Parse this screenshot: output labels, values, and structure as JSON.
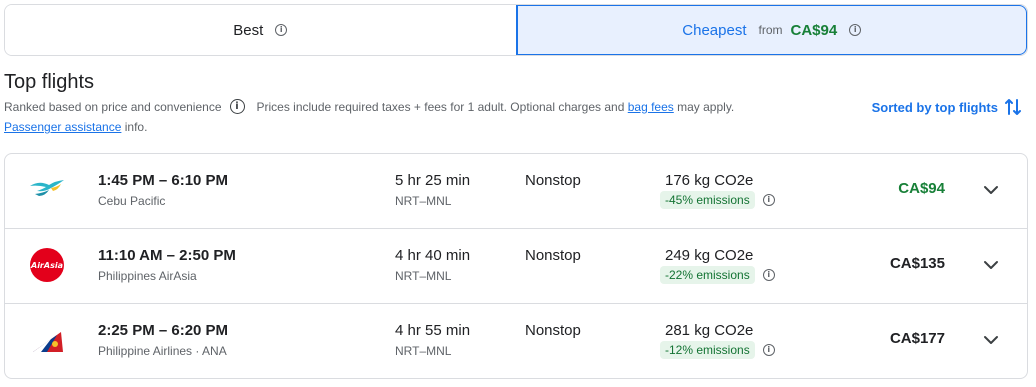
{
  "tabs": {
    "best_label": "Best",
    "cheapest_label": "Cheapest",
    "cheapest_from": "from",
    "cheapest_price": "CA$94"
  },
  "header": {
    "title": "Top flights",
    "ranked_text": "Ranked based on price and convenience",
    "prices_text": "Prices include required taxes + fees for 1 adult. Optional charges and",
    "bag_fees_link": "bag fees",
    "may_apply": "may apply.",
    "passenger_link": "Passenger assistance",
    "info_text": "info.",
    "sorted_label": "Sorted by top flights"
  },
  "flights": [
    {
      "times": "1:45 PM – 6:10 PM",
      "airline": "Cebu Pacific",
      "duration": "5 hr 25 min",
      "route": "NRT–MNL",
      "stops": "Nonstop",
      "co2": "176 kg CO2e",
      "emissions": "-45% emissions",
      "price": "CA$94",
      "logo_icon": "cebu-pacific-logo"
    },
    {
      "times": "11:10 AM – 2:50 PM",
      "airline": "Philippines AirAsia",
      "duration": "4 hr 40 min",
      "route": "NRT–MNL",
      "stops": "Nonstop",
      "co2": "249 kg CO2e",
      "emissions": "-22% emissions",
      "price": "CA$135",
      "logo_icon": "airasia-logo",
      "logo_text": "AirAsia"
    },
    {
      "times": "2:25 PM – 6:20 PM",
      "airline": "Philippine Airlines · ANA",
      "duration": "4 hr 55 min",
      "route": "NRT–MNL",
      "stops": "Nonstop",
      "co2": "281 kg CO2e",
      "emissions": "-12% emissions",
      "price": "CA$177",
      "logo_icon": "philippine-airlines-logo"
    }
  ],
  "colors": {
    "accent": "#1a73e8",
    "cheapest_bg": "#e8f0fe",
    "price_green": "#188038",
    "emissions_bg": "#e6f4ea",
    "airasia_red": "#e3001b"
  }
}
